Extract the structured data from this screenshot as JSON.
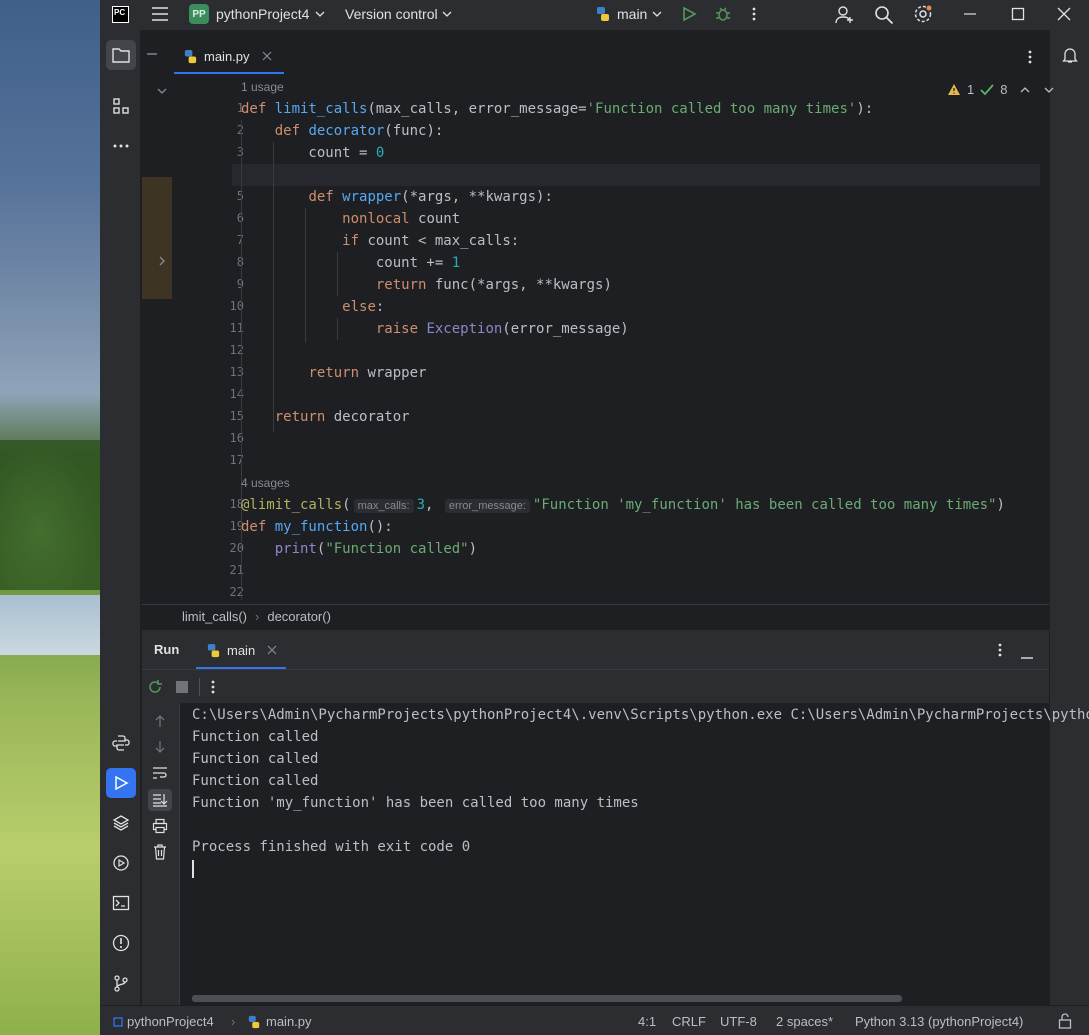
{
  "titlebar": {
    "logo": "PC",
    "project_badge": "PP",
    "project_name": "pythonProject4",
    "vcs_label": "Version control",
    "run_config": "main"
  },
  "editor": {
    "tab_label": "main.py",
    "usage_top": "1 usage",
    "usage_mid": "4 usages",
    "warnings_count": "1",
    "ok_count": "8",
    "line_numbers": [
      "1",
      "2",
      "3",
      "4",
      "5",
      "6",
      "7",
      "8",
      "9",
      "10",
      "11",
      "12",
      "13",
      "14",
      "15",
      "16",
      "17",
      "18",
      "19",
      "20",
      "21",
      "22"
    ],
    "hint_max_calls": "max_calls:",
    "hint_error_message": "error_message:"
  },
  "breadcrumb": {
    "items": [
      "limit_calls()",
      "decorator()"
    ]
  },
  "run_panel": {
    "title": "Run",
    "tab_label": "main",
    "console_lines": [
      "C:\\Users\\Admin\\PycharmProjects\\pythonProject4\\.venv\\Scripts\\python.exe C:\\Users\\Admin\\PycharmProjects\\pytho",
      "Function called",
      "Function called",
      "Function called",
      "Function 'my_function' has been called too many times",
      "",
      "Process finished with exit code 0"
    ]
  },
  "statusbar": {
    "project": "pythonProject4",
    "file": "main.py",
    "position": "4:1",
    "line_ending": "CRLF",
    "encoding": "UTF-8",
    "indent": "2 spaces*",
    "interpreter": "Python 3.13 (pythonProject4)"
  },
  "colors": {
    "accent": "#3574f0",
    "keyword": "#cf8e6d",
    "function": "#56a8f5",
    "string": "#6aab73",
    "number": "#2aacb8"
  }
}
